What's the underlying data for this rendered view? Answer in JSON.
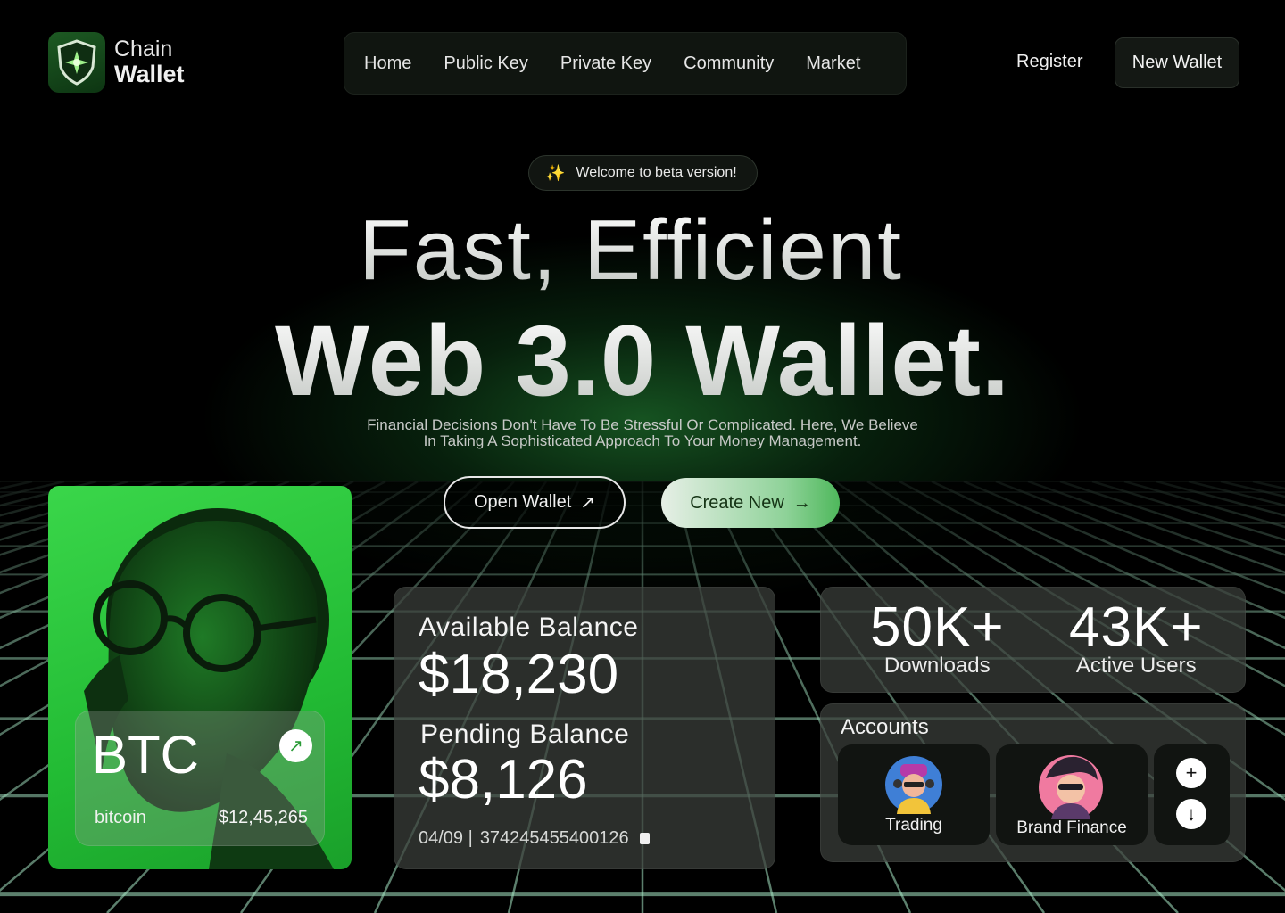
{
  "brand": {
    "line1": "Chain",
    "line2": "Wallet",
    "accent": "#2ec441"
  },
  "nav": {
    "items": [
      {
        "label": "Home"
      },
      {
        "label": "Public Key"
      },
      {
        "label": "Private Key"
      },
      {
        "label": "Community"
      },
      {
        "label": "Market"
      }
    ],
    "register": "Register",
    "new_wallet": "New Wallet"
  },
  "hero": {
    "badge": "Welcome to beta version!",
    "title_line1": "Fast, Efficient",
    "title_line2": "Web 3.0 Wallet.",
    "subtitle_line1": "Financial Decisions Don't Have To Be Stressful Or Complicated. Here, We Believe",
    "subtitle_line2": "In Taking A Sophisticated Approach To Your Money Management.",
    "btn_open": "Open Wallet",
    "btn_open_icon": "↗",
    "btn_create": "Create New",
    "btn_create_icon": "→"
  },
  "btc_card": {
    "symbol": "BTC",
    "name": "bitcoin",
    "price": "$12,45,265",
    "arrow_icon": "↗"
  },
  "balance": {
    "available_label": "Available Balance",
    "available_value": "$18,230",
    "pending_label": "Pending Balance",
    "pending_value": "$8,126",
    "expiry": "04/09 |",
    "card_number": "374245455400126"
  },
  "stats": [
    {
      "value": "50K+",
      "label": "Downloads"
    },
    {
      "value": "43K+",
      "label": "Active Users"
    }
  ],
  "accounts": {
    "title": "Accounts",
    "items": [
      {
        "label": "Trading"
      },
      {
        "label": "Brand Finance"
      }
    ],
    "add_icon": "+",
    "download_icon": "↓"
  }
}
